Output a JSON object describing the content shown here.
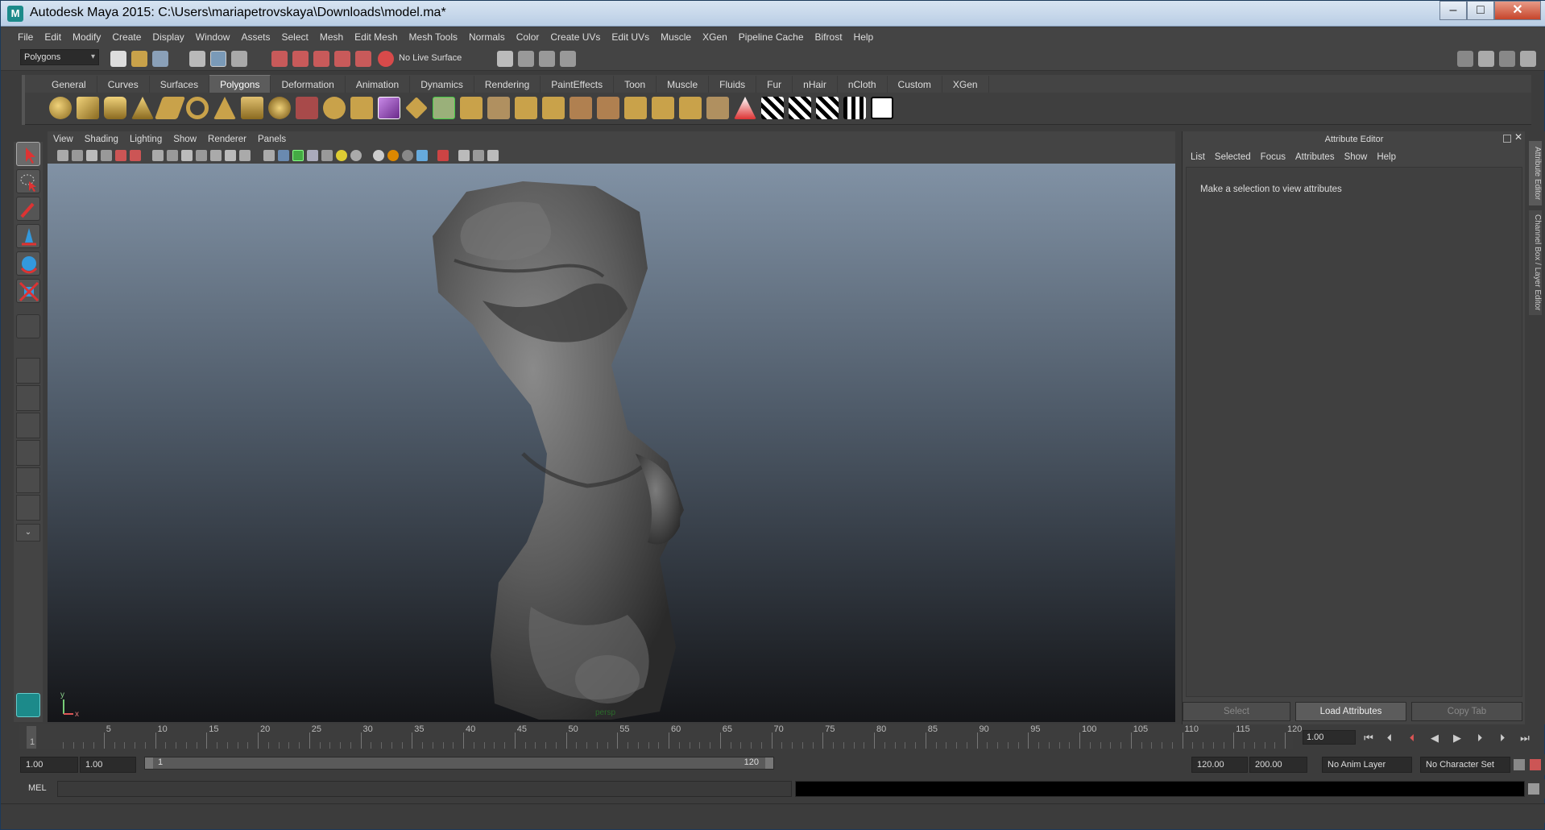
{
  "window": {
    "title": "Autodesk Maya 2015: C:\\Users\\mariapetrovskaya\\Downloads\\model.ma*"
  },
  "menubar": [
    "File",
    "Edit",
    "Modify",
    "Create",
    "Display",
    "Window",
    "Assets",
    "Select",
    "Mesh",
    "Edit Mesh",
    "Mesh Tools",
    "Normals",
    "Color",
    "Create UVs",
    "Edit UVs",
    "Muscle",
    "XGen",
    "Pipeline Cache",
    "Bifrost",
    "Help"
  ],
  "status_line": {
    "mode_selector": "Polygons",
    "live_surface": "No Live Surface"
  },
  "shelf_tabs": [
    "General",
    "Curves",
    "Surfaces",
    "Polygons",
    "Deformation",
    "Animation",
    "Dynamics",
    "Rendering",
    "PaintEffects",
    "Toon",
    "Muscle",
    "Fluids",
    "Fur",
    "nHair",
    "nCloth",
    "Custom",
    "XGen"
  ],
  "shelf_active_tab": "Polygons",
  "viewport": {
    "menu": [
      "View",
      "Shading",
      "Lighting",
      "Show",
      "Renderer",
      "Panels"
    ],
    "camera_label": "persp",
    "axis_y": "y",
    "axis_x": "x"
  },
  "attribute_editor": {
    "title": "Attribute Editor",
    "menu": [
      "List",
      "Selected",
      "Focus",
      "Attributes",
      "Show",
      "Help"
    ],
    "message": "Make a selection to view attributes",
    "buttons": {
      "select": "Select",
      "load": "Load Attributes",
      "copy": "Copy Tab"
    }
  },
  "side_tabs": {
    "attribute_editor": "Attribute Editor",
    "channel_box": "Channel Box / Layer Editor"
  },
  "timeline": {
    "ticks": [
      "5",
      "10",
      "15",
      "20",
      "25",
      "30",
      "35",
      "40",
      "45",
      "50",
      "55",
      "60",
      "65",
      "70",
      "75",
      "80",
      "85",
      "90",
      "95",
      "100",
      "105",
      "110",
      "115",
      "120"
    ],
    "start_label": "1",
    "current_frame": "1.00"
  },
  "range": {
    "start": "1.00",
    "playback_start": "1.00",
    "slider_start": "1",
    "slider_end": "120",
    "playback_end": "120.00",
    "end": "200.00",
    "anim_layer": "No Anim Layer",
    "character_set": "No Character Set"
  },
  "command_line": {
    "label": "MEL"
  },
  "colors": {
    "accent": "#5c5c5c",
    "viewport_top": "#8192a5",
    "viewport_bottom": "#141518",
    "model": "#6a6a6a"
  }
}
